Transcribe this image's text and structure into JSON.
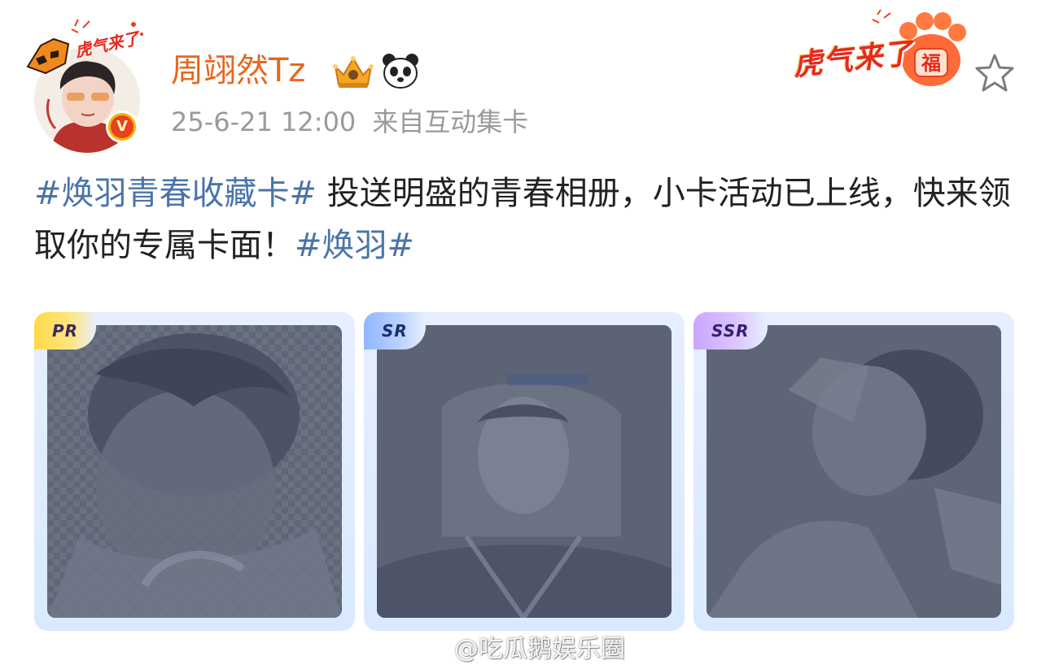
{
  "post": {
    "author": {
      "name": "周翊然Tz",
      "avatar_pendant_text": "虎气来了",
      "verified_mark": "V"
    },
    "meta": {
      "timestamp": "25-6-21 12:00",
      "source": "来自互动集卡"
    },
    "festival_badge": {
      "text": "虎气来了",
      "paw_char": "福"
    },
    "text": {
      "hashtag_1": "#焕羽青春收藏卡#",
      "body": " 投送明盛的青春相册，小卡活动已上线，快来领取你的专属卡面！",
      "hashtag_2": "#焕羽#"
    },
    "cards": [
      {
        "rarity": "PR"
      },
      {
        "rarity": "SR"
      },
      {
        "rarity": "SSR"
      }
    ]
  },
  "watermark": {
    "text": "@吃瓜鹅娱乐圈"
  },
  "icons": {
    "star": "star-outline-icon",
    "crown": "crown-badge-icon",
    "panda": "panda-icon",
    "weibo": "weibo-logo-icon"
  },
  "colors": {
    "username": "#e8661d",
    "hashtag": "#4a74a8",
    "meta": "#9a9a9a",
    "text": "#222222"
  }
}
